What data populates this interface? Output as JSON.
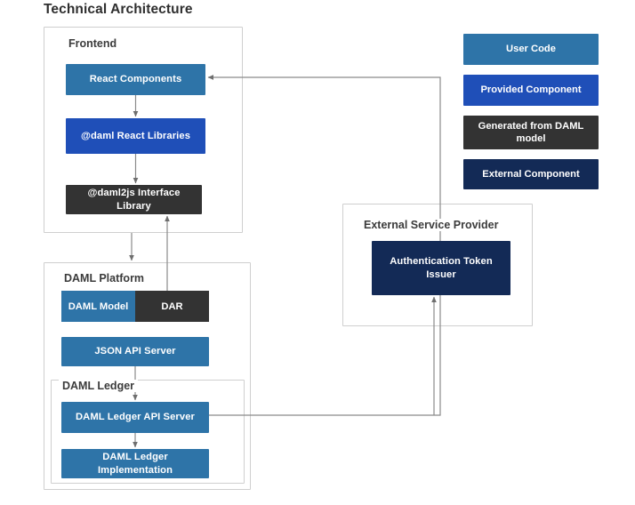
{
  "title": "Technical Architecture",
  "groups": {
    "frontend": "Frontend",
    "platform": "DAML Platform",
    "ledger": "DAML Ledger",
    "external": "External Service Provider"
  },
  "nodes": {
    "react_components": "React Components",
    "daml_react_libraries": "@daml React Libraries",
    "daml2js_interface_library": "@daml2js Interface Library",
    "daml_model": "DAML Model",
    "dar": "DAR",
    "json_api_server": "JSON API Server",
    "daml_ledger_api_server": "DAML Ledger API Server",
    "daml_ledger_implementation": "DAML Ledger Implementation",
    "authentication_token_issuer": "Authentication Token Issuer"
  },
  "legend": [
    {
      "label": "User Code",
      "color": "#2E74A8",
      "class": "c-user"
    },
    {
      "label": "Provided Component",
      "color": "#1F4FB8",
      "class": "c-provided"
    },
    {
      "label": "Generated from DAML model",
      "color": "#333333",
      "class": "c-generated"
    },
    {
      "label": "External Component",
      "color": "#132A56",
      "class": "c-external"
    }
  ],
  "colors": {
    "user_code": "#2E74A8",
    "provided_component": "#1F4FB8",
    "generated_from_daml": "#333333",
    "external_component": "#132A56",
    "group_border": "#cfcfcf",
    "connector": "#777777",
    "title_text": "#2f2f2f",
    "background": "#ffffff"
  },
  "connectors": [
    {
      "name": "react-to-daml-react",
      "from": "react_components",
      "to": "daml_react_libraries"
    },
    {
      "name": "daml-react-to-daml2js",
      "from": "daml_react_libraries",
      "to": "daml2js_interface_library"
    },
    {
      "name": "frontend-to-platform",
      "from": "daml2js_interface_library",
      "to": "daml_model"
    },
    {
      "name": "dar-to-daml2js",
      "from": "dar",
      "to": "daml2js_interface_library"
    },
    {
      "name": "json-api-to-ledger-api",
      "from": "json_api_server",
      "to": "daml_ledger_api_server"
    },
    {
      "name": "ledger-api-to-ledger-impl",
      "from": "daml_ledger_api_server",
      "to": "daml_ledger_implementation"
    },
    {
      "name": "ledger-api-to-react",
      "from": "daml_ledger_api_server",
      "to": "react_components"
    },
    {
      "name": "ledger-api-to-auth-token",
      "from": "daml_ledger_api_server",
      "to": "authentication_token_issuer"
    }
  ]
}
